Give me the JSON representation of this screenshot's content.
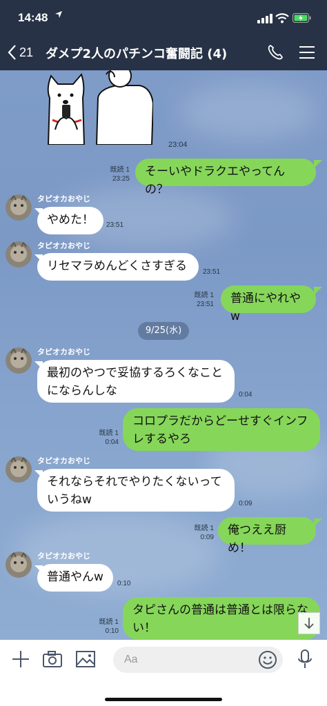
{
  "status_bar": {
    "time": "14:48",
    "location_icon": "location-arrow-icon",
    "signal": "cellular-signal-icon",
    "wifi": "wifi-icon",
    "battery": "battery-charging-icon"
  },
  "header": {
    "back_count": "21",
    "title": "ダメプ2人のパチンコ奮闘記 (4)",
    "icons": [
      "back-chevron-icon",
      "phone-icon",
      "menu-icon"
    ]
  },
  "sticker": {
    "time": "23:04"
  },
  "messages": [
    {
      "side": "right",
      "text": "そーいやドラクエやってんの？",
      "read": "既読 1",
      "time": "23:25"
    },
    {
      "side": "left",
      "sender": "タピオカおやじ",
      "text": "やめた！",
      "time": "23:51"
    },
    {
      "side": "left",
      "sender": "タピオカおやじ",
      "text": "リセマラめんどくさすぎる",
      "time": "23:51"
    },
    {
      "side": "right",
      "text": "普通にやれやw",
      "read": "既読 1",
      "time": "23:51"
    },
    {
      "side": "left",
      "sender": "タピオカおやじ",
      "text": "最初のやつで妥協するろくなこと\nにならんしな",
      "time": "0:04"
    },
    {
      "side": "right",
      "text": "コロプラだからどーせすぐインフ\nレするやろ",
      "read": "既読 1",
      "time": "0:04"
    },
    {
      "side": "left",
      "sender": "タピオカおやじ",
      "text": "それならそれでやりたくないって\nいうねw",
      "time": "0:09"
    },
    {
      "side": "right",
      "text": "俺つええ厨め！",
      "read": "既読 1",
      "time": "0:09"
    },
    {
      "side": "left",
      "sender": "タピオカおやじ",
      "text": "普通やんw",
      "time": "0:10"
    },
    {
      "side": "right",
      "text": "タピさんの普通は普通とは限らな\nい！",
      "read": "既読 1",
      "time": "0:10"
    }
  ],
  "date_separator": "9/25(水)",
  "input": {
    "placeholder": "Aa"
  },
  "colors": {
    "header_bg": "#273246",
    "chat_bg": "#7f9cc8",
    "bubble_right": "#86d65a",
    "bubble_left": "#ffffff"
  }
}
